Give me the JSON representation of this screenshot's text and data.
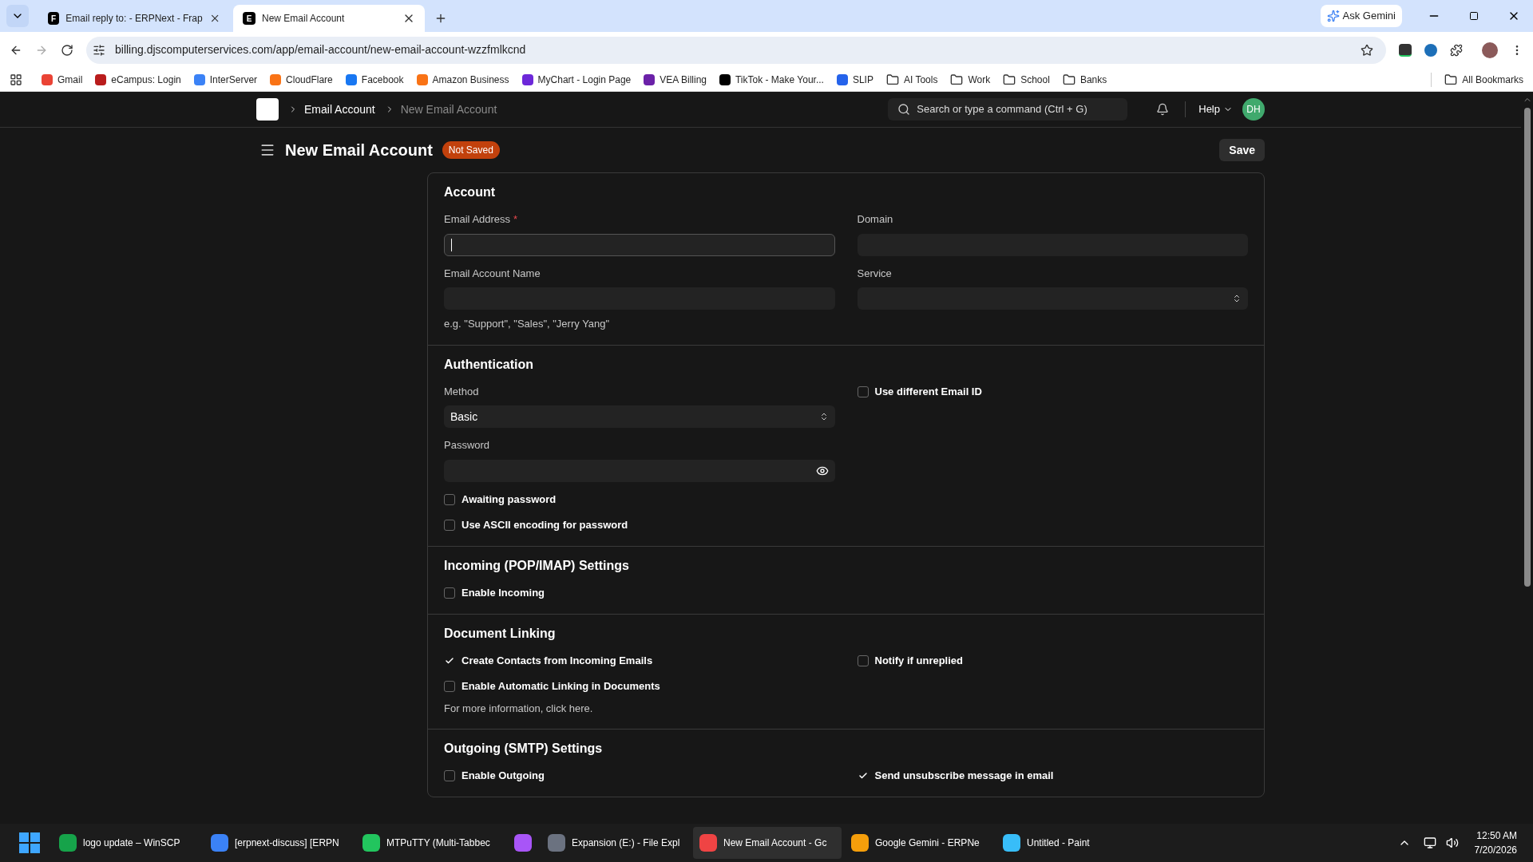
{
  "browser": {
    "tabs": [
      {
        "icon_letter": "F",
        "title": "Email reply to: - ERPNext - Frap",
        "selected": false
      },
      {
        "icon_letter": "E",
        "title": "New Email Account",
        "selected": true
      }
    ],
    "url": "billing.djscomputerservices.com/app/email-account/new-email-account-wzzfmlkcnd",
    "ask_gemini": "Ask Gemini",
    "bookmarks": [
      {
        "kind": "site",
        "label": "Gmail",
        "color": "#ea4335"
      },
      {
        "kind": "site",
        "label": "eCampus: Login",
        "color": "#b91c1c"
      },
      {
        "kind": "site",
        "label": "InterServer",
        "color": "#3b82f6"
      },
      {
        "kind": "site",
        "label": "CloudFlare",
        "color": "#f97316"
      },
      {
        "kind": "site",
        "label": "Facebook",
        "color": "#1877f2"
      },
      {
        "kind": "site",
        "label": "Amazon Business",
        "color": "#f97316"
      },
      {
        "kind": "site",
        "label": "MyChart - Login Page",
        "color": "#6d28d9"
      },
      {
        "kind": "site",
        "label": "VEA Billing",
        "color": "#6b21a8"
      },
      {
        "kind": "site",
        "label": "TikTok - Make Your...",
        "color": "#000000"
      },
      {
        "kind": "site",
        "label": "SLIP",
        "color": "#2563eb"
      },
      {
        "kind": "folder",
        "label": "AI Tools"
      },
      {
        "kind": "folder",
        "label": "Work"
      },
      {
        "kind": "folder",
        "label": "School"
      },
      {
        "kind": "folder",
        "label": "Banks"
      }
    ],
    "all_bookmarks": "All Bookmarks"
  },
  "navbar": {
    "breadcrumbs": [
      "Email Account",
      "New Email Account"
    ],
    "search": {
      "placeholder": "Search or type a command (Ctrl + G)"
    },
    "help": "Help",
    "avatar": "DH"
  },
  "page": {
    "title": "New Email Account",
    "status": "Not Saved",
    "save": "Save"
  },
  "sections": [
    {
      "title": "Account",
      "left": [
        {
          "kind": "text",
          "label": "Email Address",
          "required_mark": "*",
          "focused": true
        },
        {
          "kind": "text",
          "label": "Email Account Name",
          "focused": false,
          "description": "e.g. \"Support\", \"Sales\", \"Jerry Yang\""
        }
      ],
      "right": [
        {
          "kind": "text",
          "label": "Domain",
          "focused": false
        },
        {
          "kind": "select",
          "label": "Service"
        }
      ]
    },
    {
      "title": "Authentication",
      "left": [
        {
          "kind": "select",
          "label": "Method",
          "value": "Basic"
        },
        {
          "kind": "password",
          "label": "Password"
        },
        {
          "kind": "checkbox",
          "label": "Awaiting password",
          "checked": false
        },
        {
          "kind": "checkbox",
          "label": "Use ASCII encoding for password",
          "checked": false
        }
      ],
      "right": [
        {
          "kind": "checkbox",
          "label": "Use different Email ID",
          "checked": false
        }
      ]
    },
    {
      "title": "Incoming (POP/IMAP) Settings",
      "left": [
        {
          "kind": "checkbox",
          "label": "Enable Incoming",
          "checked": false
        }
      ]
    },
    {
      "title": "Document Linking",
      "left": [
        {
          "kind": "checkbox",
          "label": "Create Contacts from Incoming Emails",
          "checked": true
        },
        {
          "kind": "checkbox",
          "label": "Enable Automatic Linking in Documents",
          "checked": false,
          "description": "For more information, click here."
        }
      ],
      "right": [
        {
          "kind": "checkbox",
          "label": "Notify if unreplied",
          "checked": false
        }
      ]
    },
    {
      "title": "Outgoing (SMTP) Settings",
      "left": [
        {
          "kind": "checkbox",
          "label": "Enable Outgoing",
          "checked": false
        }
      ],
      "right": [
        {
          "kind": "checkbox",
          "label": "Send unsubscribe message in email",
          "checked": true
        }
      ]
    }
  ],
  "taskbar": {
    "apps": [
      {
        "label": "logo update – WinSCP",
        "color": "#16a34a",
        "active": false
      },
      {
        "label": "[erpnext-discuss] [ERPN",
        "color": "#3b82f6",
        "active": false
      },
      {
        "label": "MTPuTTY (Multi-Tabbec",
        "color": "#22c55e",
        "active": false
      },
      {
        "color": "#a855f7",
        "active": false
      },
      {
        "label": "Expansion (E:) - File Expl",
        "color": "#6b7280",
        "active": false
      },
      {
        "label": "New Email Account - Gc",
        "color": "#ef4444",
        "active": true
      },
      {
        "label": "Google Gemini - ERPNe",
        "color": "#f59e0b",
        "active": false
      },
      {
        "label": "Untitled - Paint",
        "color": "#38bdf8",
        "active": false
      }
    ],
    "time": "12:50 AM",
    "date": "7/20/2026"
  }
}
